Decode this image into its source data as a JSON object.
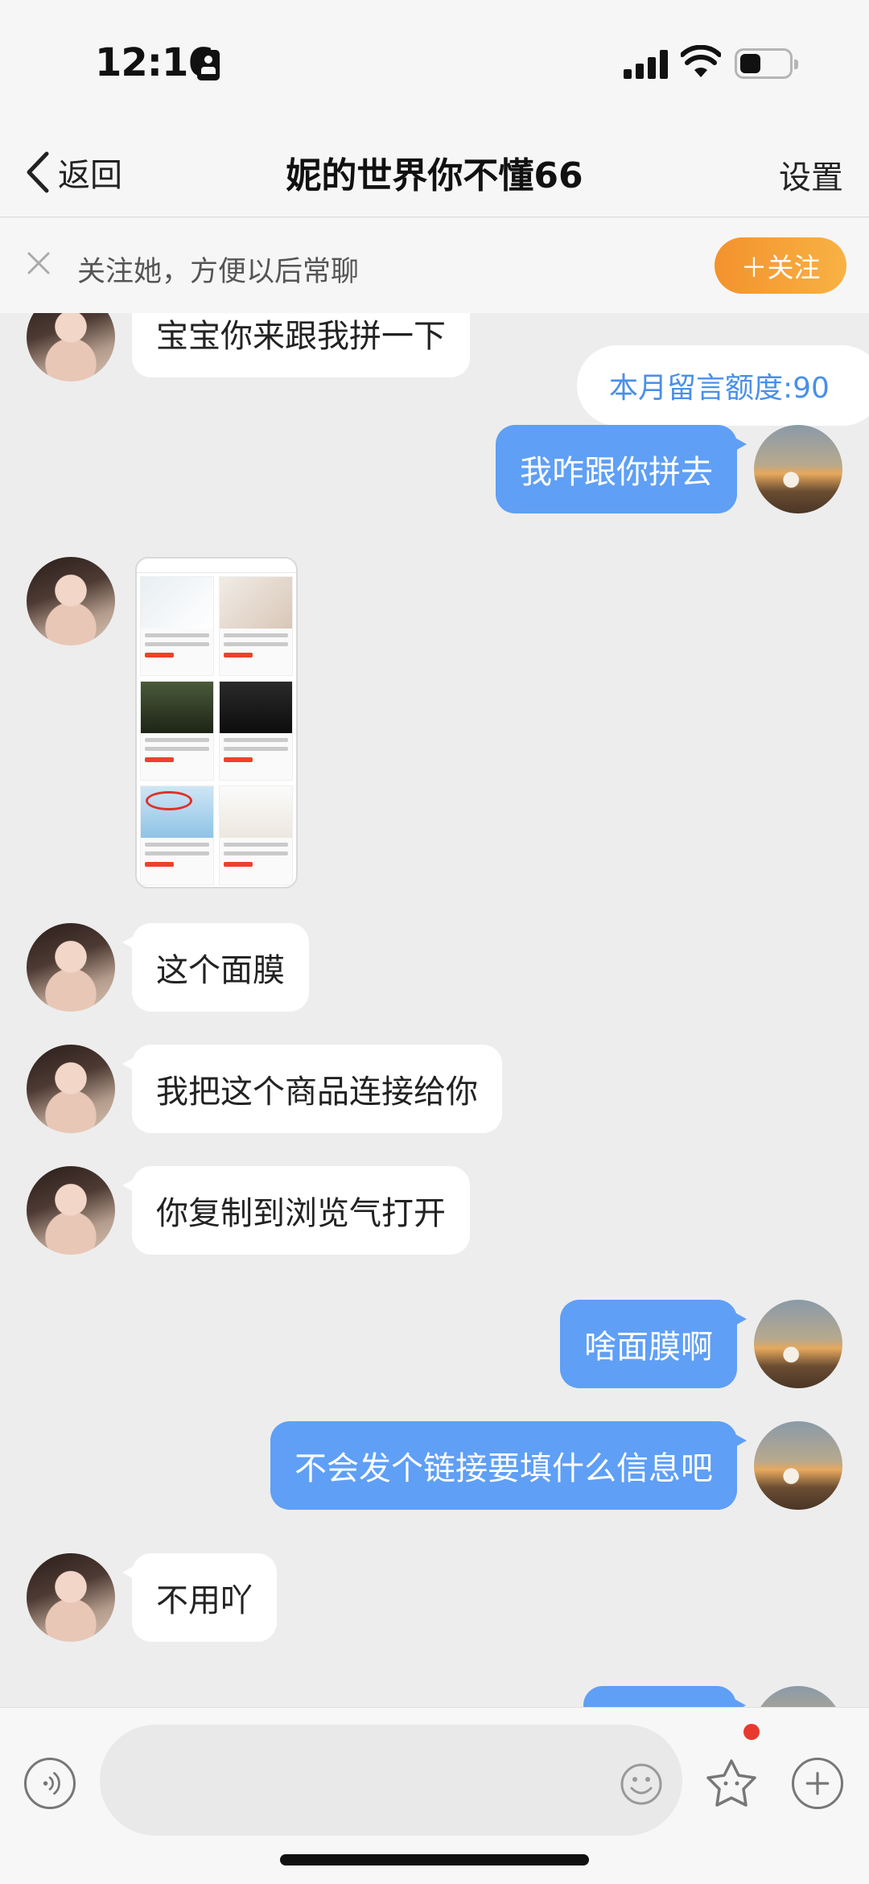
{
  "status_bar": {
    "time": "12:16"
  },
  "nav": {
    "back_label": "返回",
    "title": "妮的世界你不懂66",
    "settings_label": "设置"
  },
  "follow_bar": {
    "prompt": "关注她，方便以后常聊",
    "button_label": "＋关注",
    "accent_color": "#f5a033"
  },
  "chat": {
    "quota_label": "本月留言额度:90",
    "messages": [
      {
        "from": "her",
        "text": "宝宝你来跟我拼一下"
      },
      {
        "from": "me",
        "text": "我咋跟你拼去"
      },
      {
        "from": "her",
        "type": "image",
        "text": ""
      },
      {
        "from": "her",
        "text": "这个面膜"
      },
      {
        "from": "her",
        "text": "我把这个商品连接给你"
      },
      {
        "from": "her",
        "text": "你复制到浏览气打开"
      },
      {
        "from": "me",
        "text": "啥面膜啊"
      },
      {
        "from": "me",
        "text": "不会发个链接要填什么信息吧"
      },
      {
        "from": "her",
        "text": "不用吖"
      }
    ],
    "outgoing_color": "#5f9ff5",
    "incoming_color": "#ffffff"
  },
  "input_bar": {
    "icons": [
      "voice-icon",
      "emoji-icon",
      "sticker-icon",
      "plus-icon"
    ],
    "placeholder": ""
  }
}
